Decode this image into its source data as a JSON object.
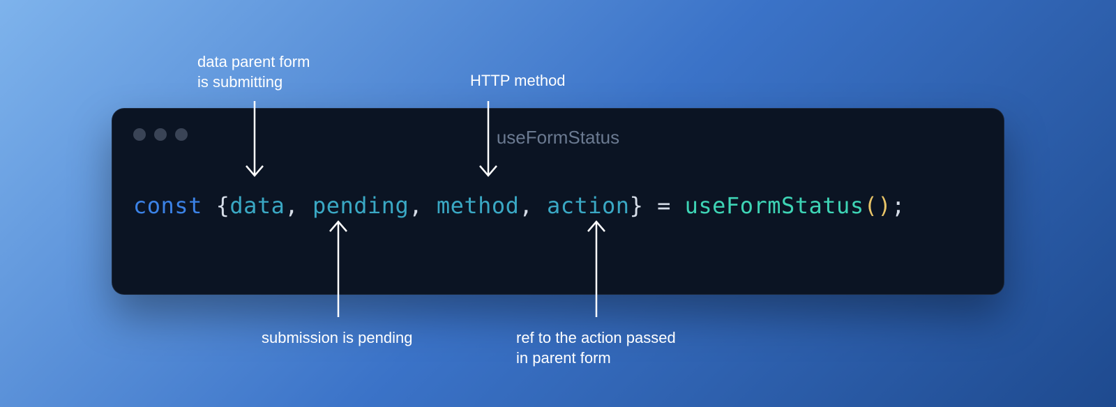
{
  "window": {
    "title": "useFormStatus"
  },
  "code": {
    "keyword": "const",
    "braceOpen": " {",
    "prop1": "data",
    "prop2": "pending",
    "prop3": "method",
    "prop4": "action",
    "braceClose": "}",
    "equals": " = ",
    "call": "useFormStatus",
    "parenOpen": "(",
    "parenClose": ")",
    "semi": ";",
    "comma": ", "
  },
  "annotations": {
    "data": "data parent form\nis submitting",
    "method": "HTTP method",
    "pending": "submission is pending",
    "action": "ref to the action passed\nin parent form"
  }
}
